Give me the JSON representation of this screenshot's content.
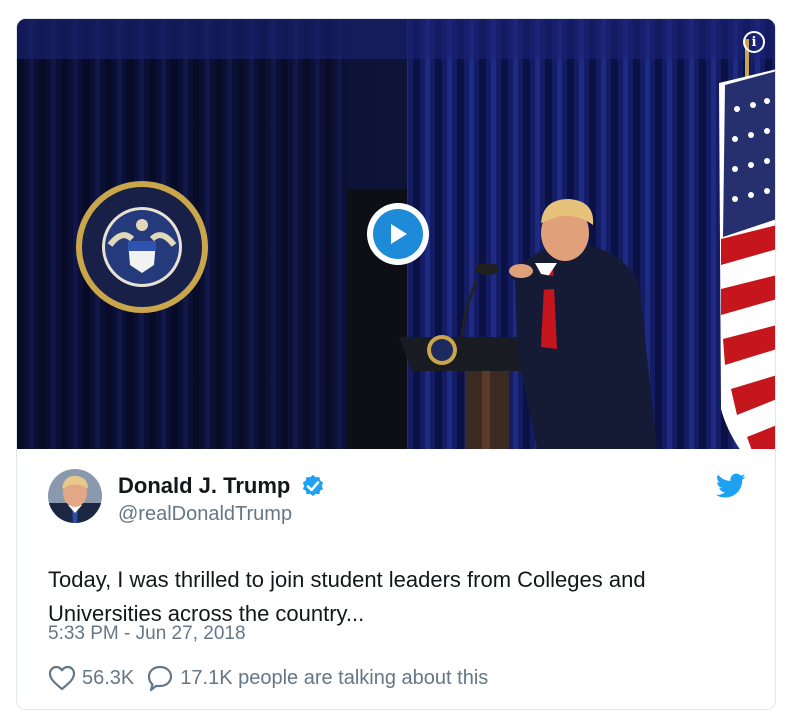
{
  "media": {
    "play_icon": "play-icon",
    "info_icon": "info-icon",
    "info_glyph": "i"
  },
  "author": {
    "display_name": "Donald J. Trump",
    "handle": "@realDonaldTrump",
    "verified_icon": "verified-badge-icon",
    "platform_icon": "twitter-bird-icon"
  },
  "tweet": {
    "text_lines": [
      "Today, I was thrilled to join student leaders from Colleges and",
      "Universities across the country..."
    ],
    "timestamp": "5:33 PM - Jun 27, 2018"
  },
  "actions": {
    "likes_count": "56.3K",
    "conversation_text": "17.1K people are talking about this"
  },
  "colors": {
    "accent": "#1da1f2",
    "play": "#1d8bd8",
    "text": "#14171a",
    "muted": "#657786"
  }
}
